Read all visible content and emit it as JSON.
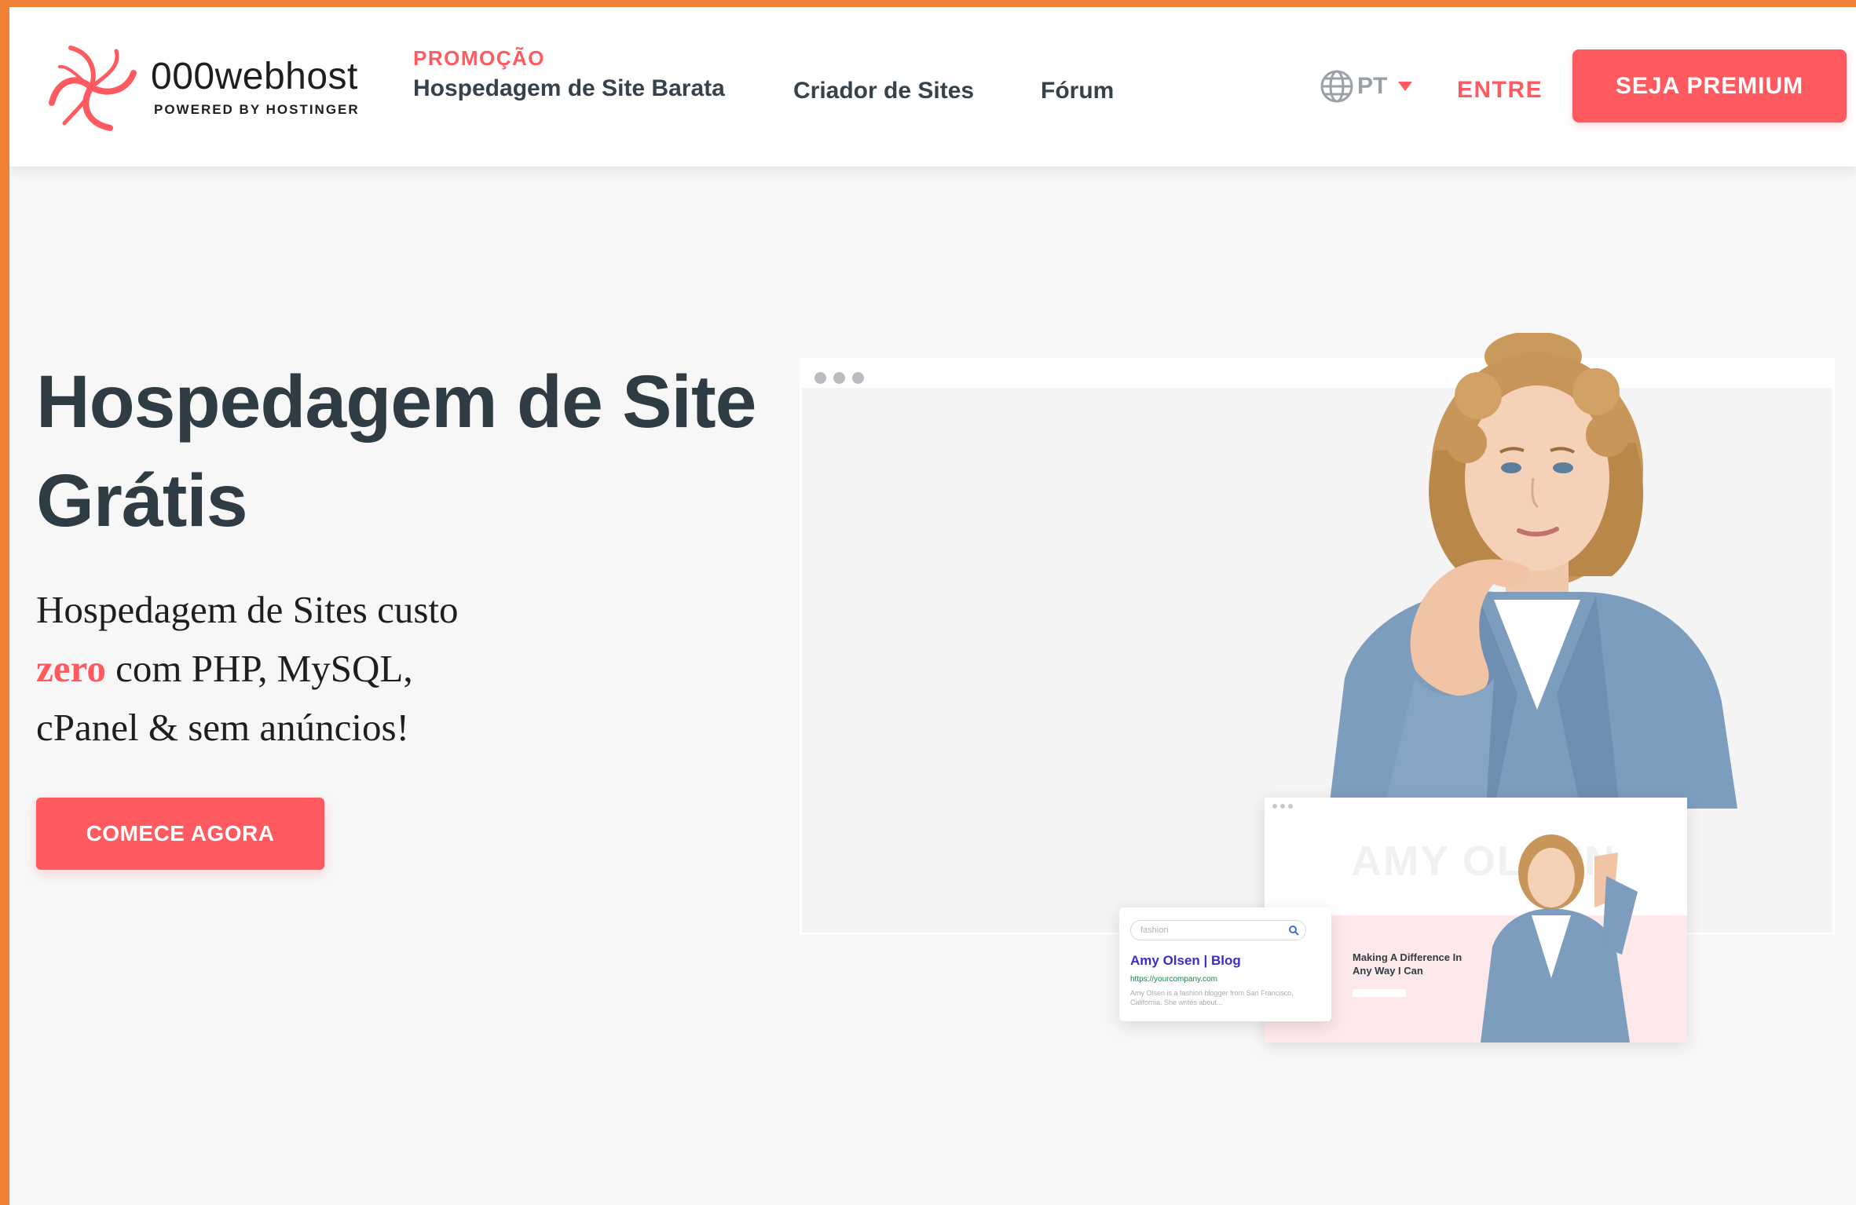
{
  "brand": {
    "name": "000webhost",
    "tagline": "POWERED BY HOSTINGER",
    "accent_color": "#ff5a5f",
    "frame_color": "#ef8035"
  },
  "nav": {
    "promo_badge": "PROMOÇÃO",
    "promo_link": "Hospedagem de Site Barata",
    "builder_link": "Criador de Sites",
    "forum_link": "Fórum",
    "language_code": "PT",
    "login_label": "ENTRE",
    "premium_button": "SEJA PREMIUM"
  },
  "hero": {
    "title": "Hospedagem de Site Grátis",
    "subtitle_before": "Hospedagem de Sites custo",
    "subtitle_accent": "zero",
    "subtitle_after": "com PHP, MySQL, cPanel & sem anúncios!",
    "cta_button": "COMECE AGORA"
  },
  "illustration": {
    "mini_site_hero_text": "AMY OLSEN",
    "mini_site_heading": "Making A Difference In Any Way I Can",
    "search_query": "fashion",
    "result_title": "Amy Olsen | Blog",
    "result_url": "https://yourcompany.com",
    "result_description": "Amy Olsen is a fashion blogger from San Francisco, California. She writes about..."
  }
}
